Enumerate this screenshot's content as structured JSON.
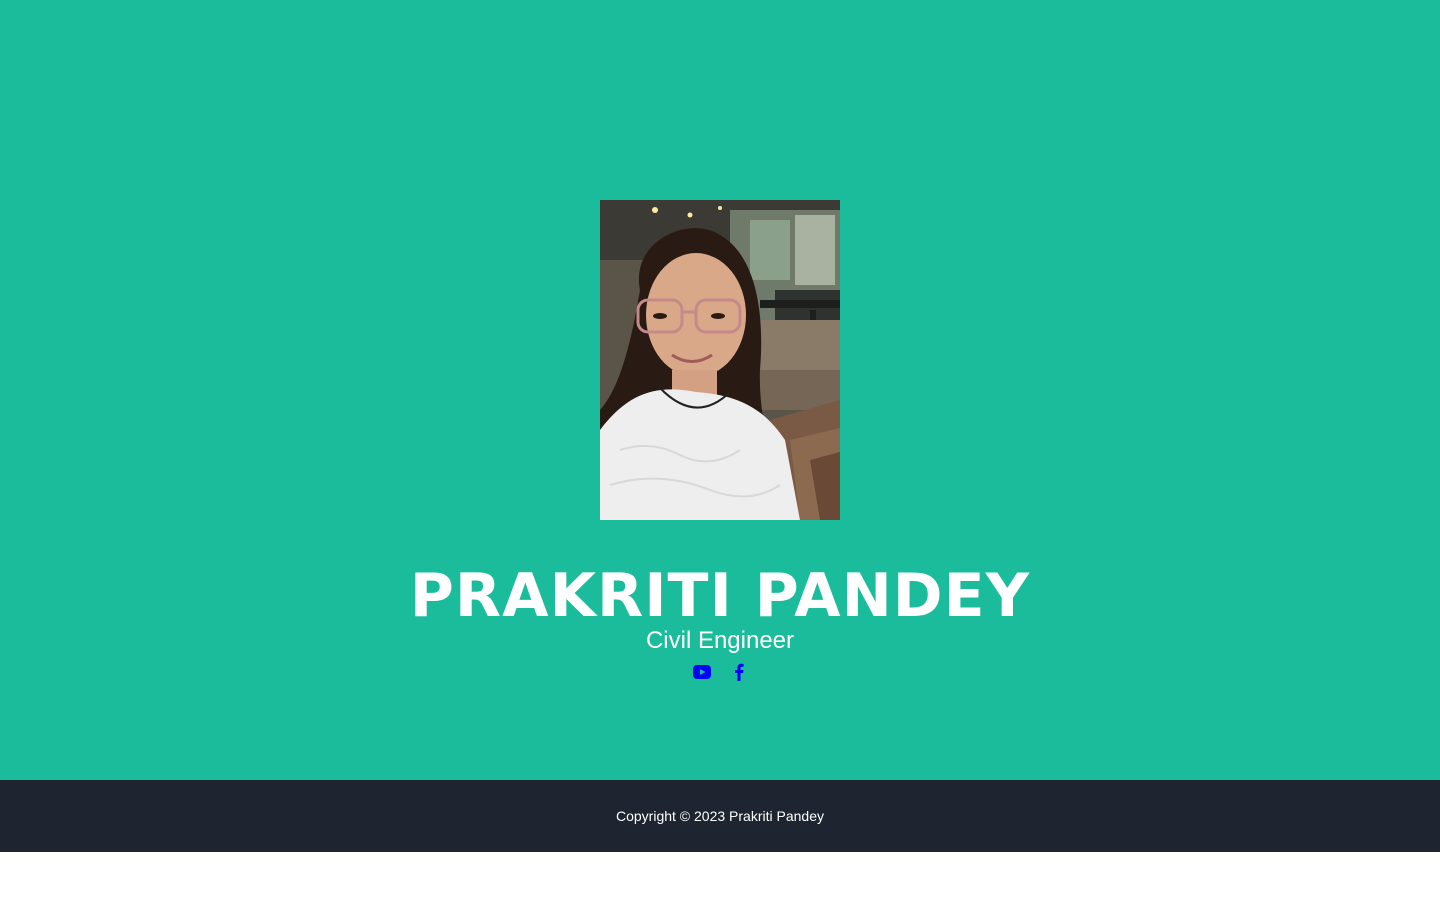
{
  "profile": {
    "name": "PRAKRITI PANDEY",
    "role": "Civil Engineer",
    "photo_alt": "portrait-photo"
  },
  "socials": [
    {
      "icon": "youtube-icon",
      "color": "#0000ff"
    },
    {
      "icon": "facebook-icon",
      "color": "#0000ff"
    }
  ],
  "footer": {
    "copyright": "Copyright © 2023 Prakriti Pandey"
  },
  "colors": {
    "hero_bg": "#1abc9c",
    "footer_bg": "#1e2530",
    "text": "#ffffff",
    "icon": "#0000ff"
  }
}
